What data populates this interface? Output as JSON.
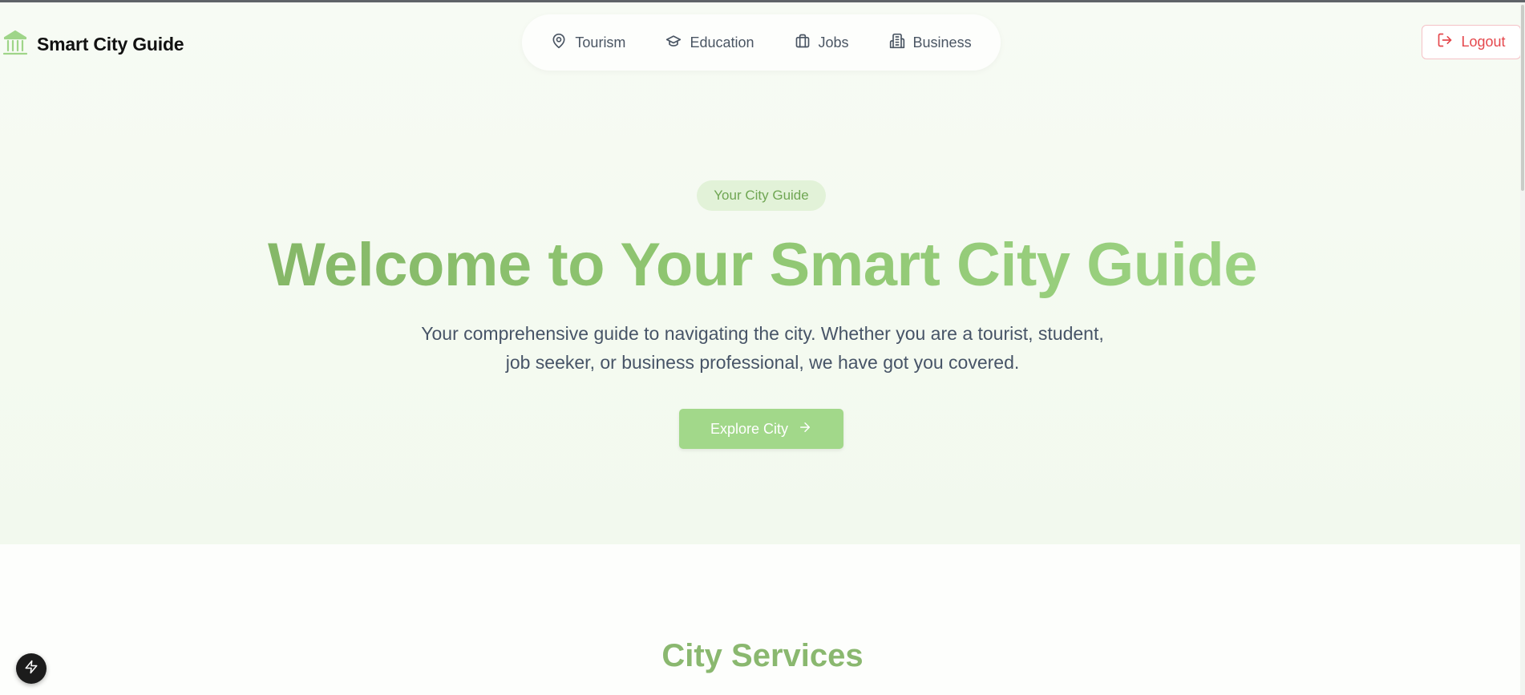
{
  "header": {
    "brand_title": "Smart City Guide",
    "brand_icon": "landmark-icon",
    "nav": [
      {
        "label": "Tourism",
        "icon": "map-pin-icon"
      },
      {
        "label": "Education",
        "icon": "graduation-cap-icon"
      },
      {
        "label": "Jobs",
        "icon": "briefcase-icon"
      },
      {
        "label": "Business",
        "icon": "building-icon"
      }
    ],
    "logout_label": "Logout"
  },
  "hero": {
    "badge": "Your City Guide",
    "headline": "Welcome to Your Smart City Guide",
    "subtitle_line1": "Your comprehensive guide to navigating the city. Whether you are a tourist, student,",
    "subtitle_line2": "job seeker, or business professional, we have got you covered.",
    "cta_label": "Explore City"
  },
  "services": {
    "title": "City Services"
  },
  "colors": {
    "accent": "#a2d88a",
    "accent_dark": "#7fae62",
    "logout": "#e5484d",
    "text": "#475467"
  }
}
